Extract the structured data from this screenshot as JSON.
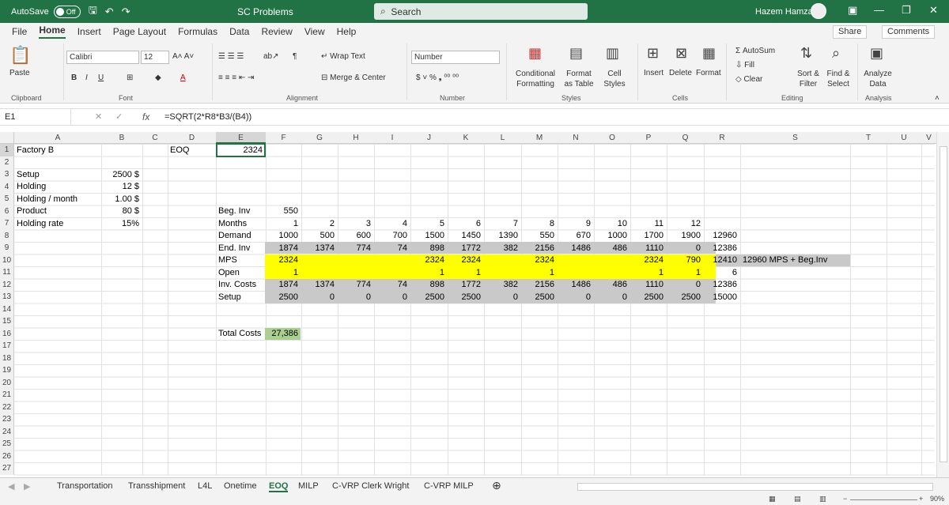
{
  "titlebar": {
    "autosave_label": "AutoSave",
    "autosave_state": "Off",
    "doc_title": "SC Problems",
    "search_placeholder": "Search",
    "user_name": "Hazem Hamza"
  },
  "menu": {
    "tabs": [
      "File",
      "Home",
      "Insert",
      "Page Layout",
      "Formulas",
      "Data",
      "Review",
      "View",
      "Help"
    ],
    "active": "Home",
    "share": "Share",
    "comments": "Comments"
  },
  "ribbon": {
    "paste": "Paste",
    "clipboard": "Clipboard",
    "font_name": "Calibri",
    "font_size": "12",
    "font": "Font",
    "wrap_text": "Wrap Text",
    "merge_center": "Merge & Center",
    "alignment": "Alignment",
    "number_format": "Number",
    "number": "Number",
    "conditional": "Conditional Formatting",
    "format_table": "Format as Table",
    "cell_styles": "Cell Styles",
    "styles": "Styles",
    "insert": "Insert",
    "delete": "Delete",
    "format": "Format",
    "cells": "Cells",
    "autosum": "AutoSum",
    "fill": "Fill",
    "clear": "Clear",
    "sort_filter": "Sort & Filter",
    "find_select": "Find & Select",
    "editing": "Editing",
    "analyze_data": "Analyze Data",
    "analysis": "Analysis"
  },
  "formula_bar": {
    "name_box": "E1",
    "fx": "fx",
    "formula": "=SQRT(2*R8*B3/(B4))"
  },
  "columns": [
    "A",
    "B",
    "C",
    "D",
    "E",
    "F",
    "G",
    "H",
    "I",
    "J",
    "K",
    "L",
    "M",
    "N",
    "O",
    "P",
    "Q",
    "R",
    "S",
    "T",
    "U",
    "V"
  ],
  "rows": [
    "1",
    "2",
    "3",
    "4",
    "5",
    "6",
    "7",
    "8",
    "9",
    "10",
    "11",
    "12",
    "13",
    "14",
    "15",
    "16",
    "17",
    "18",
    "19",
    "20",
    "21",
    "22",
    "23",
    "24",
    "25",
    "26",
    "27"
  ],
  "cells": {
    "a1": "Factory B",
    "d1": "EOQ",
    "e1": "2324",
    "a3": "Setup",
    "b3": "2500 $",
    "a4": "Holding",
    "b4": "12 $",
    "a5": "Holding / month",
    "b5": "1.00 $",
    "a6": "Product",
    "b6": "80 $",
    "a7": "Holding rate",
    "b7": "15%",
    "e6": "Beg. Inv",
    "f6": "550",
    "e7": "Months",
    "e8": "Demand",
    "e9": "End. Inv",
    "e10": "MPS",
    "e11": "Open",
    "e12": "Inv. Costs",
    "e13": "Setup",
    "e16": "Total Costs",
    "f16": "27,386",
    "r8": "12960",
    "r9": "12386",
    "r10": "12410",
    "r11": "6",
    "r12": "12386",
    "r13": "15000",
    "s10": "12960 MPS + Beg.Inv"
  },
  "table": {
    "months": [
      "1",
      "2",
      "3",
      "4",
      "5",
      "6",
      "7",
      "8",
      "9",
      "10",
      "11",
      "12"
    ],
    "demand": [
      "1000",
      "500",
      "600",
      "700",
      "1500",
      "1450",
      "1390",
      "550",
      "670",
      "1000",
      "1700",
      "1900"
    ],
    "end_inv": [
      "1874",
      "1374",
      "774",
      "74",
      "898",
      "1772",
      "382",
      "2156",
      "1486",
      "486",
      "1110",
      "0"
    ],
    "mps": [
      "2324",
      "",
      "",
      "",
      "2324",
      "2324",
      "",
      "2324",
      "",
      "",
      "2324",
      "790"
    ],
    "open": [
      "1",
      "",
      "",
      "",
      "1",
      "1",
      "",
      "1",
      "",
      "",
      "1",
      "1"
    ],
    "inv_costs": [
      "1874",
      "1374",
      "774",
      "74",
      "898",
      "1772",
      "382",
      "2156",
      "1486",
      "486",
      "1110",
      "0"
    ],
    "setup": [
      "2500",
      "0",
      "0",
      "0",
      "2500",
      "2500",
      "0",
      "2500",
      "0",
      "0",
      "2500",
      "2500"
    ]
  },
  "sheets": [
    "Transportation",
    "Transshipment",
    "L4L",
    "Onetime",
    "EOQ",
    "MILP",
    "C-VRP Clerk Wright",
    "C-VRP MILP"
  ],
  "active_sheet": "EOQ",
  "zoom": "90%",
  "colors": {
    "excel_green": "#217346",
    "highlight_yellow": "#ffff00",
    "highlight_gray": "#c9c9c9",
    "total_green": "#a9d08e"
  }
}
